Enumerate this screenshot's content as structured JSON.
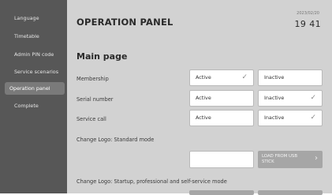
{
  "sidebar": {
    "items": [
      {
        "label": "Language"
      },
      {
        "label": "Timetable"
      },
      {
        "label": "Admin PIN code"
      },
      {
        "label": "Service scenarios"
      },
      {
        "label": "Operation panel"
      },
      {
        "label": "Complete"
      }
    ],
    "active_index": 4
  },
  "header": {
    "title": "OPERATION PANEL",
    "date": "2023/02/20",
    "time": "19 41"
  },
  "main": {
    "section_title": "Main page",
    "rows": [
      {
        "label": "Membership",
        "active_label": "Active",
        "inactive_label": "Inactive",
        "selected": "active"
      },
      {
        "label": "Serial number",
        "active_label": "Active",
        "inactive_label": "Inactive",
        "selected": "inactive"
      },
      {
        "label": "Service call",
        "active_label": "Active",
        "inactive_label": "Inactive",
        "selected": "inactive"
      }
    ],
    "logo_standard_label": "Change Logo: Standard mode",
    "logo_field_value": "",
    "load_button_label": "LOAD FROM USB STICK",
    "logo_startup_label": "Change Logo: Startup, professional and self-service mode"
  },
  "icons": {
    "check": "check-icon",
    "arrow": "chevron-right-icon"
  },
  "colors": {
    "sidebar_bg": "#575757",
    "main_bg": "#d2d2d2",
    "button_bg": "#a6a6a6"
  }
}
